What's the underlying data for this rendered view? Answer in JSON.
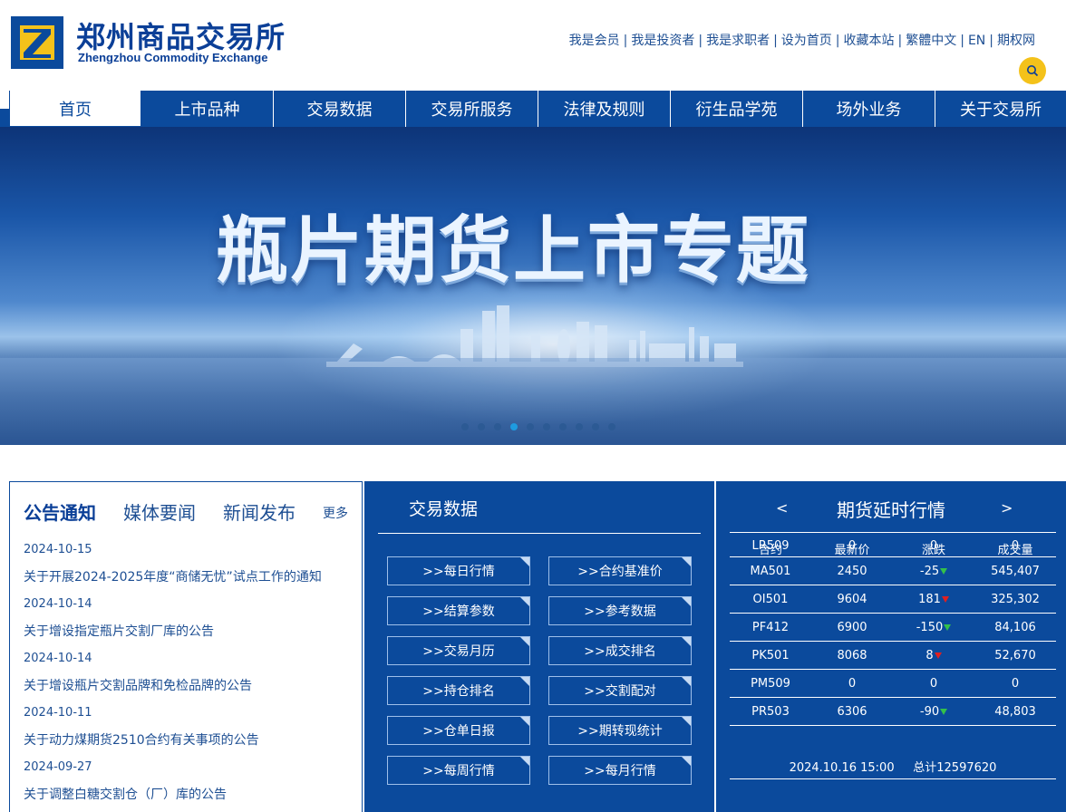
{
  "header": {
    "logo_cn": "郑州商品交易所",
    "logo_en": "Zhengzhou Commodity Exchange",
    "top_links": [
      "我是会员",
      "我是投资者",
      "我是求职者",
      "设为首页",
      "收藏本站",
      "繁體中文",
      "EN",
      "期权网"
    ]
  },
  "nav": {
    "items": [
      "首页",
      "上市品种",
      "交易数据",
      "交易所服务",
      "法律及规则",
      "衍生品学苑",
      "场外业务",
      "关于交易所"
    ]
  },
  "banner": {
    "title": "瓶片期货上市专题",
    "slide_count": 10,
    "active_slide": 4
  },
  "news": {
    "tabs": [
      "公告通知",
      "媒体要闻",
      "新闻发布"
    ],
    "more": "更多",
    "items": [
      {
        "date": "2024-10-15",
        "title": "关于开展2024-2025年度“商储无忧”试点工作的通知"
      },
      {
        "date": "2024-10-14",
        "title": "关于增设指定瓶片交割厂库的公告"
      },
      {
        "date": "2024-10-14",
        "title": "关于增设瓶片交割品牌和免检品牌的公告"
      },
      {
        "date": "2024-10-11",
        "title": "关于动力煤期货2510合约有关事项的公告"
      },
      {
        "date": "2024-09-27",
        "title": "关于调整白糖交割仓（厂）库的公告"
      }
    ]
  },
  "trade": {
    "title": "交易数据",
    "buttons": [
      ">>每日行情",
      ">>合约基准价",
      ">>结算参数",
      ">>参考数据",
      ">>交易月历",
      ">>成交排名",
      ">>持仓排名",
      ">>交割配对",
      ">>仓单日报",
      ">>期转现统计",
      ">>每周行情",
      ">>每月行情"
    ]
  },
  "quote": {
    "prev": "<",
    "next": ">",
    "title": "期货延时行情",
    "columns": [
      "合约",
      "最新价",
      "涨跌",
      "成交量"
    ],
    "rows": [
      {
        "contract": "LR509",
        "price": "0",
        "change": "0",
        "dir": "",
        "volume": "0"
      },
      {
        "contract": "MA501",
        "price": "2450",
        "change": "-25",
        "dir": "down",
        "volume": "545,407"
      },
      {
        "contract": "OI501",
        "price": "9604",
        "change": "181",
        "dir": "up",
        "volume": "325,302"
      },
      {
        "contract": "PF412",
        "price": "6900",
        "change": "-150",
        "dir": "down",
        "volume": "84,106"
      },
      {
        "contract": "PK501",
        "price": "8068",
        "change": "8",
        "dir": "up",
        "volume": "52,670"
      },
      {
        "contract": "PM509",
        "price": "0",
        "change": "0",
        "dir": "",
        "volume": "0"
      },
      {
        "contract": "PR503",
        "price": "6306",
        "change": "-90",
        "dir": "down",
        "volume": "48,803"
      }
    ],
    "timestamp": "2024.10.16 15:00",
    "total": "总计12597620"
  },
  "colors": {
    "primary": "#0b4a9c",
    "accent": "#f4c21a",
    "up": "#e02020",
    "down": "#34c04a"
  }
}
